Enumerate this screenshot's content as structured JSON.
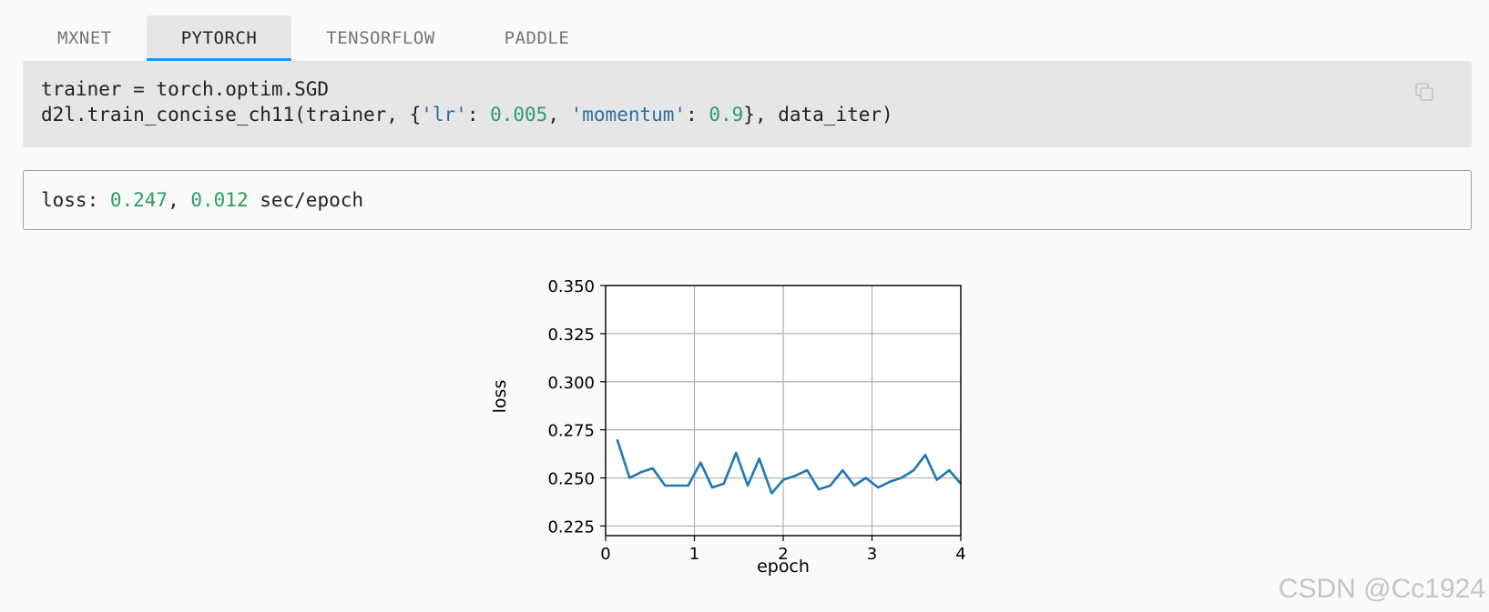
{
  "tabs": [
    {
      "label": "MXNET",
      "active": false
    },
    {
      "label": "PYTORCH",
      "active": true
    },
    {
      "label": "TENSORFLOW",
      "active": false
    },
    {
      "label": "PADDLE",
      "active": false
    }
  ],
  "code": {
    "line1": "trainer = torch.optim.SGD",
    "line2": {
      "prefix": "d2l.train_concise_ch11(trainer, {",
      "key1": "'lr'",
      "sep1": ": ",
      "val1": "0.005",
      "comma": ", ",
      "key2": "'momentum'",
      "sep2": ": ",
      "val2": "0.9",
      "suffix": "}, data_iter)"
    },
    "copy_icon": "copy-icon"
  },
  "output": {
    "label": "loss: ",
    "loss": "0.247",
    "sep": ", ",
    "time": "0.012",
    "unit": " sec/epoch"
  },
  "chart_data": {
    "type": "line",
    "xlabel": "epoch",
    "ylabel": "loss",
    "xlim": [
      0,
      4
    ],
    "ylim": [
      0.22,
      0.35
    ],
    "xticks": [
      "0",
      "1",
      "2",
      "3",
      "4"
    ],
    "yticks": [
      "0.225",
      "0.250",
      "0.275",
      "0.300",
      "0.325",
      "0.350"
    ],
    "grid": true,
    "line_color": "#1f77b4",
    "series": [
      {
        "x": [
          0.13,
          0.27,
          0.4,
          0.53,
          0.67,
          0.8,
          0.93,
          1.07,
          1.2,
          1.33,
          1.47,
          1.6,
          1.73,
          1.87,
          2.0,
          2.13,
          2.27,
          2.4,
          2.53,
          2.67,
          2.8,
          2.93,
          3.07,
          3.2,
          3.33,
          3.47,
          3.6,
          3.73,
          3.87,
          4.0
        ],
        "values": [
          0.27,
          0.25,
          0.253,
          0.255,
          0.246,
          0.246,
          0.246,
          0.258,
          0.245,
          0.247,
          0.263,
          0.246,
          0.26,
          0.242,
          0.249,
          0.251,
          0.254,
          0.244,
          0.246,
          0.254,
          0.246,
          0.25,
          0.245,
          0.248,
          0.25,
          0.254,
          0.262,
          0.249,
          0.254,
          0.247
        ]
      }
    ]
  },
  "watermark": "CSDN @Cc1924"
}
